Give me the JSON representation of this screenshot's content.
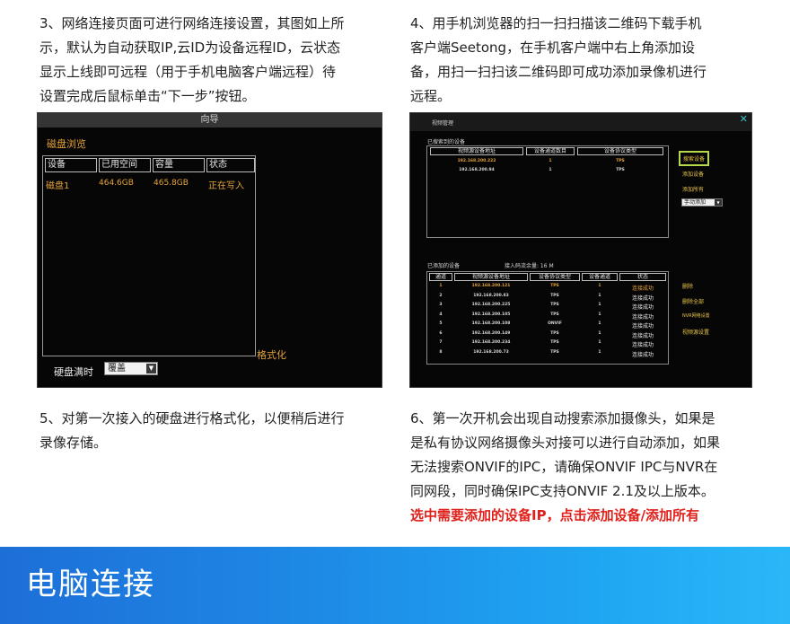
{
  "step3": {
    "lines": [
      "3、网络连接页面可进行网络连接设置，其图如上所",
      "示，默认为自动获取IP,云ID为设备远程ID，云状态",
      "显示上线即可远程（用于手机电脑客户端远程）待",
      "设置完成后鼠标单击“下一步”按钮。"
    ]
  },
  "step4": {
    "lines": [
      "4、用手机浏览器的扫一扫扫描该二维码下载手机",
      "客户端Seetong，在手机客户端中右上角添加设",
      "备，用扫一扫扫该二维码即可成功添加录像机进行",
      "远程。"
    ]
  },
  "step5": {
    "lines": [
      "5、对第一次接入的硬盘进行格式化，以便稍后进行",
      "录像存储。"
    ]
  },
  "step6": {
    "lines": [
      "6、第一次开机会出现自动搜索添加摄像头，如果是",
      "是私有协议网络摄像头对接可以进行自动添加，如果",
      "无法搜索ONVIF的IPC，请确保ONVIF IPC与NVR在",
      "同网段，同时确保IPC支持ONVIF 2.1及以上版本。"
    ],
    "highlight": "选中需要添加的设备IP，点击添加设备/添加所有"
  },
  "wizard_screen": {
    "title": "向导",
    "section": "磁盘浏览",
    "headers": [
      "设备",
      "已用空间",
      "容量",
      "状态"
    ],
    "row": [
      "磁盘1",
      "464.6GB",
      "465.8GB",
      "正在写入"
    ],
    "format_button": "格式化",
    "overwrite_label": "硬盘满时",
    "overwrite_value": "覆盖",
    "dropdown_arrow": "▼"
  },
  "video_manage_screen": {
    "title": "视频管理",
    "close": "✕",
    "searched_label": "已搜索到的设备",
    "searched_headers": [
      "视频源设备地址",
      "设备通道数目",
      "设备协议类型"
    ],
    "searched_rows": [
      [
        "192.168.200.222",
        "1",
        "TPS"
      ],
      [
        "192.168.200.94",
        "1",
        "TPS"
      ]
    ],
    "actions_top": [
      "搜索设备",
      "添加设备",
      "添加所有"
    ],
    "add_mode": "手动添加",
    "dropdown_arrow": "▼",
    "added_label": "已添加的设备",
    "bandwidth": "接入码流余量: 16 M",
    "added_headers": [
      "通道",
      "视频源设备地址",
      "设备协议类型",
      "设备通道",
      "状态"
    ],
    "added_rows": [
      [
        "1",
        "192.168.200.121",
        "TPS",
        "1",
        "连接成功"
      ],
      [
        "2",
        "192.168.200.83",
        "TPS",
        "1",
        "连接成功"
      ],
      [
        "3",
        "192.168.200.225",
        "TPS",
        "1",
        "连接成功"
      ],
      [
        "4",
        "192.168.200.105",
        "TPS",
        "1",
        "连接成功"
      ],
      [
        "5",
        "192.168.200.108",
        "ONVIF",
        "1",
        "连接成功"
      ],
      [
        "6",
        "192.168.200.149",
        "TPS",
        "1",
        "连接成功"
      ],
      [
        "7",
        "192.168.200.234",
        "TPS",
        "1",
        "连接成功"
      ],
      [
        "8",
        "192.168.200.73",
        "TPS",
        "1",
        "连接成功"
      ]
    ],
    "actions_bottom": [
      "删除",
      "删除全部",
      "NVR网络设置",
      "视频源设置"
    ]
  },
  "banner": {
    "title": "电脑连接"
  }
}
